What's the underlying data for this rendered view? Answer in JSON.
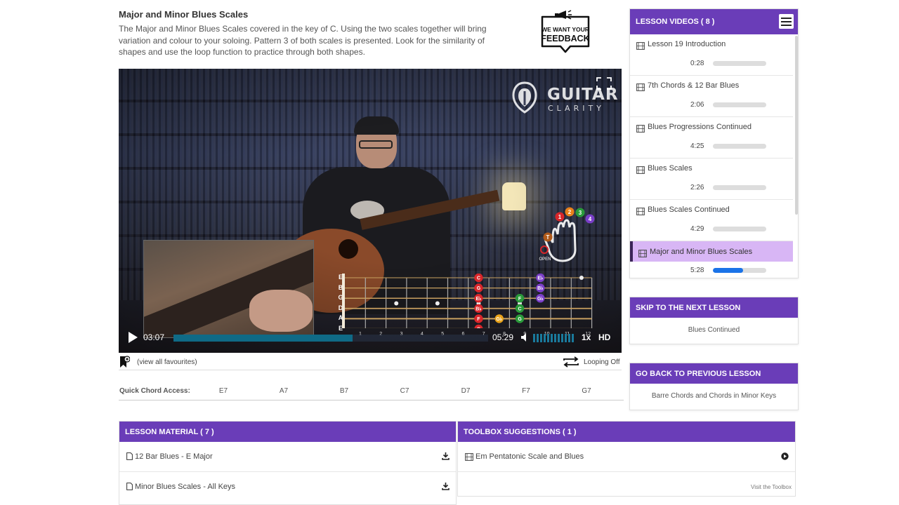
{
  "lesson": {
    "title": "Major and Minor Blues Scales",
    "description": "The Major and Minor Blues Scales covered in the key of C. Using the two scales together will bring variation and colour to your soloing. Pattern 3 of both scales is presented. Look for the similarity of shapes and use the loop function to practice through both shapes."
  },
  "feedback": {
    "line1": "WE WANT YOUR",
    "line2": "FEEDBACK"
  },
  "video": {
    "brand": "GUITAR",
    "brand_sub": "CLARITY",
    "current_time": "03:07",
    "duration": "05:29",
    "progress": 0.57,
    "playback_rate": "1x",
    "quality": "HD",
    "volume": 0.9,
    "open_label": "OPEN",
    "thumb_label": "T",
    "fingers": [
      "1",
      "2",
      "3",
      "4"
    ],
    "strings": [
      "E",
      "B",
      "G",
      "D",
      "A",
      "E"
    ],
    "fret_numbers": [
      "1",
      "2",
      "3",
      "4",
      "5",
      "6",
      "7",
      "8",
      "9",
      "10",
      "11",
      "12"
    ],
    "notes": [
      {
        "label": "C",
        "color": "#d8262a",
        "fret": 7,
        "string": 0
      },
      {
        "label": "G",
        "color": "#d8262a",
        "fret": 7,
        "string": 1
      },
      {
        "label": "E♭",
        "color": "#d8262a",
        "fret": 7,
        "string": 2
      },
      {
        "label": "B♭",
        "color": "#d8262a",
        "fret": 7,
        "string": 3
      },
      {
        "label": "F",
        "color": "#d8262a",
        "fret": 7,
        "string": 4
      },
      {
        "label": "C",
        "color": "#d8262a",
        "fret": 7,
        "string": 5
      },
      {
        "label": "G♭",
        "color": "#e8a21a",
        "fret": 8,
        "string": 4
      },
      {
        "label": "F",
        "color": "#2a9a3a",
        "fret": 9,
        "string": 2
      },
      {
        "label": "C",
        "color": "#2a9a3a",
        "fret": 9,
        "string": 3
      },
      {
        "label": "G",
        "color": "#2a9a3a",
        "fret": 9,
        "string": 4
      },
      {
        "label": "E♭",
        "color": "#7a3ec8",
        "fret": 10,
        "string": 0
      },
      {
        "label": "B♭",
        "color": "#7a3ec8",
        "fret": 10,
        "string": 1
      },
      {
        "label": "G♭",
        "color": "#7a3ec8",
        "fret": 10,
        "string": 2
      },
      {
        "label": "E♭",
        "color": "#7a3ec8",
        "fret": 10,
        "string": 6
      }
    ]
  },
  "favourites": {
    "label": "(view all favourites)",
    "loop_label": "Looping Off"
  },
  "quick_chords": {
    "label": "Quick Chord Access:",
    "chords": [
      "E7",
      "A7",
      "B7",
      "C7",
      "D7",
      "F7",
      "G7"
    ]
  },
  "sidebar": {
    "title": "LESSON VIDEOS ( 8 )",
    "videos": [
      {
        "title": "Lesson 19 Introduction",
        "duration": "0:28",
        "progress": 0
      },
      {
        "title": "7th Chords & 12 Bar Blues",
        "duration": "2:06",
        "progress": 0
      },
      {
        "title": "Blues Progressions Continued",
        "duration": "4:25",
        "progress": 0
      },
      {
        "title": "Blues Scales",
        "duration": "2:26",
        "progress": 0
      },
      {
        "title": "Blues Scales Continued",
        "duration": "4:29",
        "progress": 0
      },
      {
        "title": "Major and Minor Blues Scales",
        "duration": "5:28",
        "progress": 0.57,
        "active": true
      }
    ]
  },
  "next_lesson": {
    "title": "SKIP TO THE NEXT LESSON",
    "name": "Blues Continued"
  },
  "prev_lesson": {
    "title": "GO BACK TO PREVIOUS LESSON",
    "name": "Barre Chords and Chords in Minor Keys"
  },
  "material": {
    "title": "LESSON MATERIAL ( 7 )",
    "items": [
      "12 Bar Blues - E Major",
      "Minor Blues Scales - All Keys"
    ]
  },
  "toolbox": {
    "title": "TOOLBOX SUGGESTIONS ( 1 )",
    "items": [
      "Em Pentatonic Scale and Blues"
    ],
    "visit_label": "Visit the Toolbox"
  },
  "colors": {
    "accent": "#6a3db8",
    "active_row": "#d8b6f5",
    "progress": "#1a73e8",
    "video_progress": "#0f6a86"
  }
}
